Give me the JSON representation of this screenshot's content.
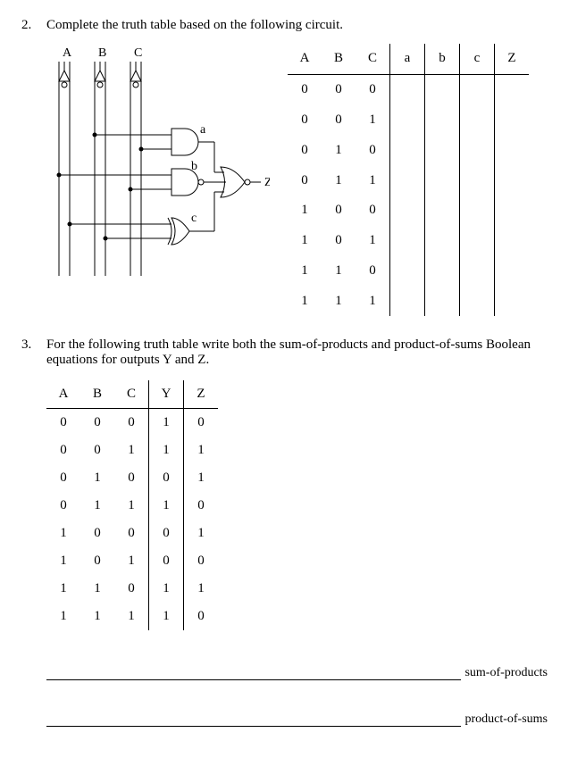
{
  "q2": {
    "number": "2.",
    "prompt": "Complete the truth table based on the following circuit.",
    "circuit": {
      "inputs": [
        "A",
        "B",
        "C"
      ],
      "gates": {
        "a": {
          "label": "a",
          "type": "AND"
        },
        "b": {
          "label": "b",
          "type": "NAND"
        },
        "c": {
          "label": "c",
          "type": "XOR"
        },
        "out": {
          "label": "Z",
          "type": "OR-wide"
        }
      }
    },
    "truth_table": {
      "headers": [
        "A",
        "B",
        "C",
        "a",
        "b",
        "c",
        "Z"
      ],
      "abc_rows": [
        [
          "0",
          "0",
          "0"
        ],
        [
          "0",
          "0",
          "1"
        ],
        [
          "0",
          "1",
          "0"
        ],
        [
          "0",
          "1",
          "1"
        ],
        [
          "1",
          "0",
          "0"
        ],
        [
          "1",
          "0",
          "1"
        ],
        [
          "1",
          "1",
          "0"
        ],
        [
          "1",
          "1",
          "1"
        ]
      ]
    }
  },
  "q3": {
    "number": "3.",
    "prompt_line1": "For the following truth table write both the sum-of-products and product-of-sums Boolean",
    "prompt_line2": "equations for outputs Y and Z.",
    "truth_table": {
      "headers": [
        "A",
        "B",
        "C",
        "Y",
        "Z"
      ],
      "rows": [
        [
          "0",
          "0",
          "0",
          "1",
          "0"
        ],
        [
          "0",
          "0",
          "1",
          "1",
          "1"
        ],
        [
          "0",
          "1",
          "0",
          "0",
          "1"
        ],
        [
          "0",
          "1",
          "1",
          "1",
          "0"
        ],
        [
          "1",
          "0",
          "0",
          "0",
          "1"
        ],
        [
          "1",
          "0",
          "1",
          "0",
          "0"
        ],
        [
          "1",
          "1",
          "0",
          "1",
          "1"
        ],
        [
          "1",
          "1",
          "1",
          "1",
          "0"
        ]
      ]
    },
    "blank_labels": {
      "sop": "sum-of-products",
      "pos": "product-of-sums"
    }
  }
}
